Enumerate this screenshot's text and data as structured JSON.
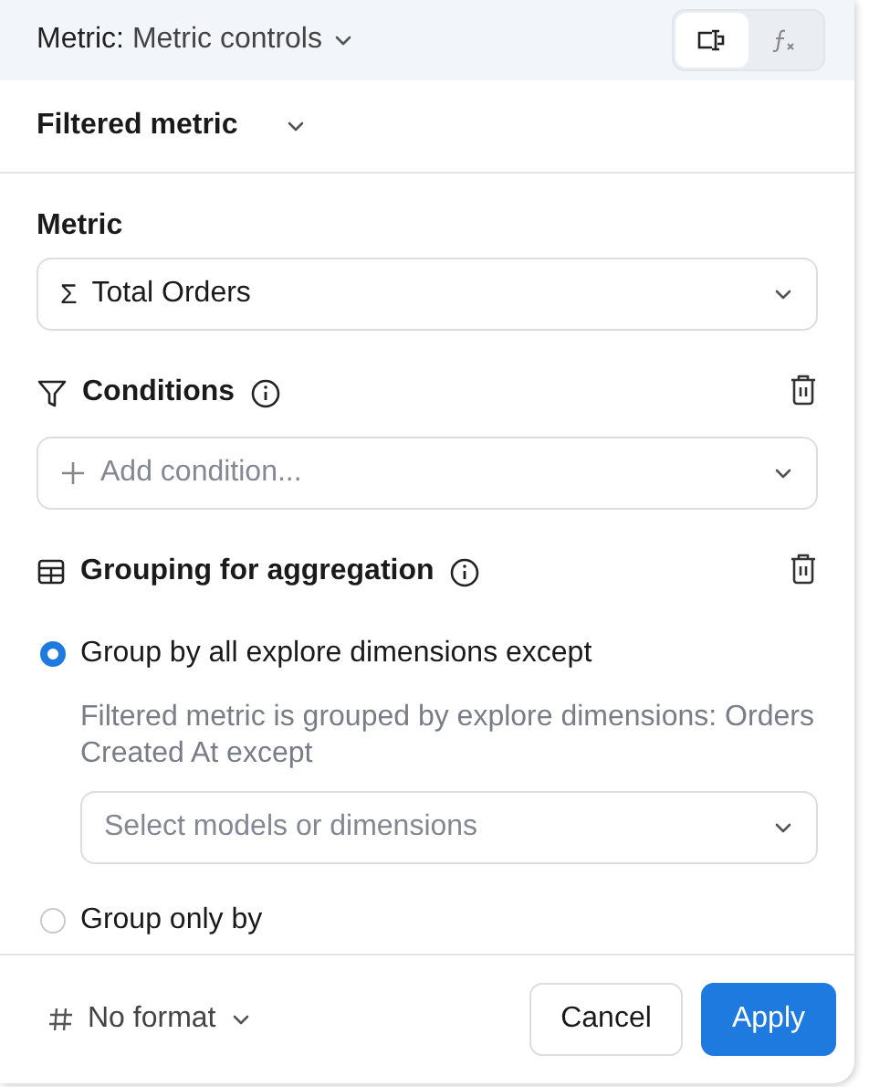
{
  "header": {
    "label": "Metric:",
    "value": "Metric controls",
    "modes": [
      {
        "kind": "visual",
        "selected": true
      },
      {
        "kind": "formula",
        "selected": false
      }
    ]
  },
  "metric_type": "Filtered metric",
  "metric": {
    "label": "Metric",
    "symbol": "Σ",
    "value": "Total Orders"
  },
  "conditions": {
    "title": "Conditions",
    "placeholder": "Add condition..."
  },
  "grouping": {
    "title": "Grouping for aggregation",
    "options": [
      {
        "label": "Group by all explore dimensions except",
        "selected": true,
        "description": "Filtered metric is grouped by explore dimensions: Orders Created At except",
        "placeholder": "Select models or dimensions"
      },
      {
        "label": "Group only by",
        "selected": false
      }
    ]
  },
  "footer": {
    "format": "No format",
    "buttons": [
      {
        "label": "Cancel",
        "kind": "secondary"
      },
      {
        "label": "Apply",
        "kind": "primary"
      }
    ]
  }
}
